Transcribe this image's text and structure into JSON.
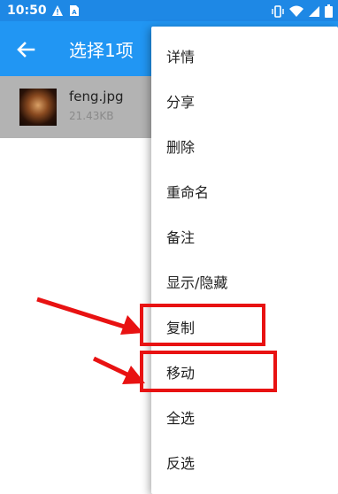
{
  "status_bar": {
    "time": "10:50",
    "left_icons": [
      "warning-icon",
      "sim-card-icon"
    ],
    "right_icons": [
      "vibrate-icon",
      "wifi-icon",
      "signal-icon",
      "battery-icon"
    ]
  },
  "app_bar": {
    "back_icon": "arrow-back-icon",
    "title": "选择1项"
  },
  "file": {
    "name": "feng.jpg",
    "size": "21.43KB"
  },
  "menu": {
    "items": [
      "详情",
      "分享",
      "删除",
      "重命名",
      "备注",
      "显示/隐藏",
      "复制",
      "移动",
      "全选",
      "反选"
    ]
  },
  "annotations": {
    "color": "#e81212",
    "highlighted_items": [
      "复制",
      "移动"
    ]
  },
  "colors": {
    "app_bar": "#2196f3",
    "status_bar": "#1e88e5",
    "selected_row": "#b3b3b3"
  }
}
